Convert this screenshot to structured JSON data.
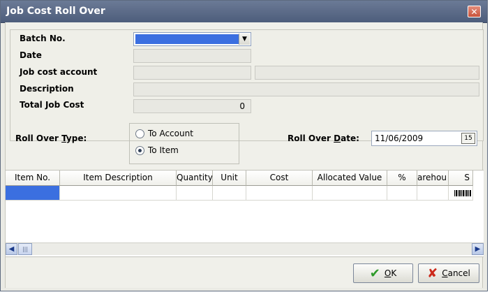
{
  "window": {
    "title": "Job Cost Roll Over",
    "close_label": "✕"
  },
  "form": {
    "batch_no": {
      "label": "Batch No.",
      "value": ""
    },
    "date": {
      "label": "Date",
      "value": ""
    },
    "job_cost_account": {
      "label": "Job cost account",
      "code": "",
      "name": ""
    },
    "description": {
      "label": "Description",
      "value": ""
    },
    "total_job_cost": {
      "label": "Total Job Cost",
      "value": "0"
    }
  },
  "roll_over_type": {
    "label_prefix": "Roll Over ",
    "label_accel": "T",
    "label_suffix": "ype:",
    "options": [
      {
        "label": "To Account",
        "selected": false
      },
      {
        "label": "To Item",
        "selected": true
      }
    ]
  },
  "roll_over_date": {
    "label_prefix": "Roll Over ",
    "label_accel": "D",
    "label_suffix": "ate:",
    "value": "11/06/2009",
    "calendar_icon": "calendar-icon",
    "calendar_glyph": "15"
  },
  "grid": {
    "columns": [
      "Item No.",
      "Item Description",
      "Quantity",
      "Unit",
      "Cost",
      "Allocated Value",
      "%",
      "arehou",
      "S"
    ],
    "rows": [
      {
        "cells": [
          "",
          "",
          "",
          "",
          "",
          "",
          "",
          "",
          ""
        ]
      }
    ]
  },
  "scrollbar": {
    "left_glyph": "◀",
    "right_glyph": "▶",
    "thumb_glyph": "|||"
  },
  "buttons": {
    "ok": {
      "label_accel": "O",
      "label_rest": "K",
      "icon": "check-icon",
      "glyph": "✔",
      "color": "#2e9a2a"
    },
    "cancel": {
      "label_accel": "C",
      "label_rest": "ancel",
      "icon": "x-icon",
      "glyph": "✘",
      "color": "#cc2a1b"
    }
  },
  "colors": {
    "title_bar": "#5b6a87",
    "selection": "#3b6fe0"
  }
}
